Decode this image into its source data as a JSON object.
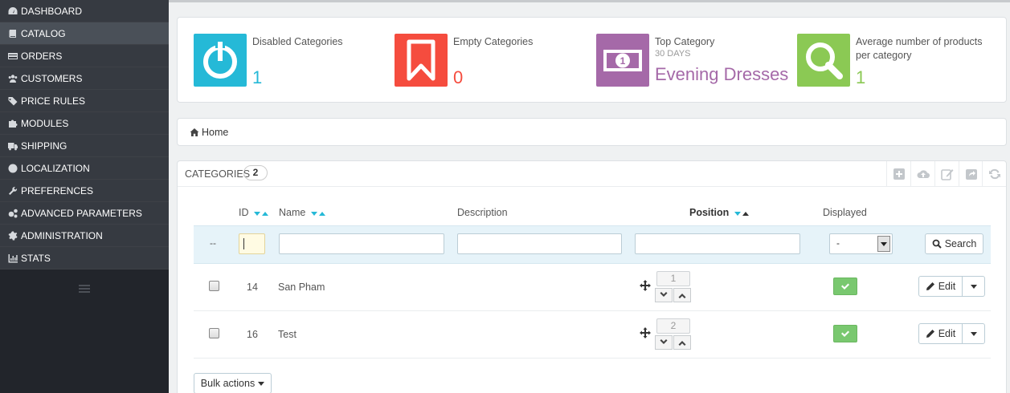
{
  "sidebar": {
    "items": [
      {
        "label": "DASHBOARD",
        "icon": "dashboard-icon"
      },
      {
        "label": "CATALOG",
        "icon": "book-icon",
        "active": true
      },
      {
        "label": "ORDERS",
        "icon": "credit-card-icon"
      },
      {
        "label": "CUSTOMERS",
        "icon": "users-icon"
      },
      {
        "label": "PRICE RULES",
        "icon": "tags-icon"
      },
      {
        "label": "MODULES",
        "icon": "puzzle-icon"
      },
      {
        "label": "SHIPPING",
        "icon": "truck-icon"
      },
      {
        "label": "LOCALIZATION",
        "icon": "globe-icon"
      },
      {
        "label": "PREFERENCES",
        "icon": "wrench-icon"
      },
      {
        "label": "ADVANCED PARAMETERS",
        "icon": "cogs-icon"
      },
      {
        "label": "ADMINISTRATION",
        "icon": "cog-icon"
      },
      {
        "label": "STATS",
        "icon": "bar-chart-icon"
      }
    ]
  },
  "kpis": [
    {
      "title": "Disabled Categories",
      "value": "1",
      "color": "#25b9d7",
      "icon": "power-icon"
    },
    {
      "title": "Empty Categories",
      "value": "0",
      "color": "#f54c3e",
      "icon": "bookmark-icon"
    },
    {
      "title": "Top Category",
      "subtitle": "30 DAYS",
      "value": "Evening Dresses",
      "color": "#a569a8",
      "icon": "money-icon"
    },
    {
      "title": "Average number of products",
      "title2": "per category",
      "value": "1",
      "color": "#8bc954",
      "icon": "magnifier-icon"
    }
  ],
  "breadcrumb": {
    "home": "Home"
  },
  "categories": {
    "title": "CATEGORIES",
    "count": "2",
    "columns": {
      "id": "ID",
      "name": "Name",
      "description": "Description",
      "position": "Position",
      "displayed": "Displayed"
    },
    "filter": {
      "dashes": "--",
      "displayed_value": "-",
      "search_label": "Search"
    },
    "rows": [
      {
        "id": "14",
        "name": "San Pham",
        "position": "1"
      },
      {
        "id": "16",
        "name": "Test",
        "position": "2"
      }
    ],
    "edit_label": "Edit",
    "bulk_label": "Bulk actions"
  }
}
